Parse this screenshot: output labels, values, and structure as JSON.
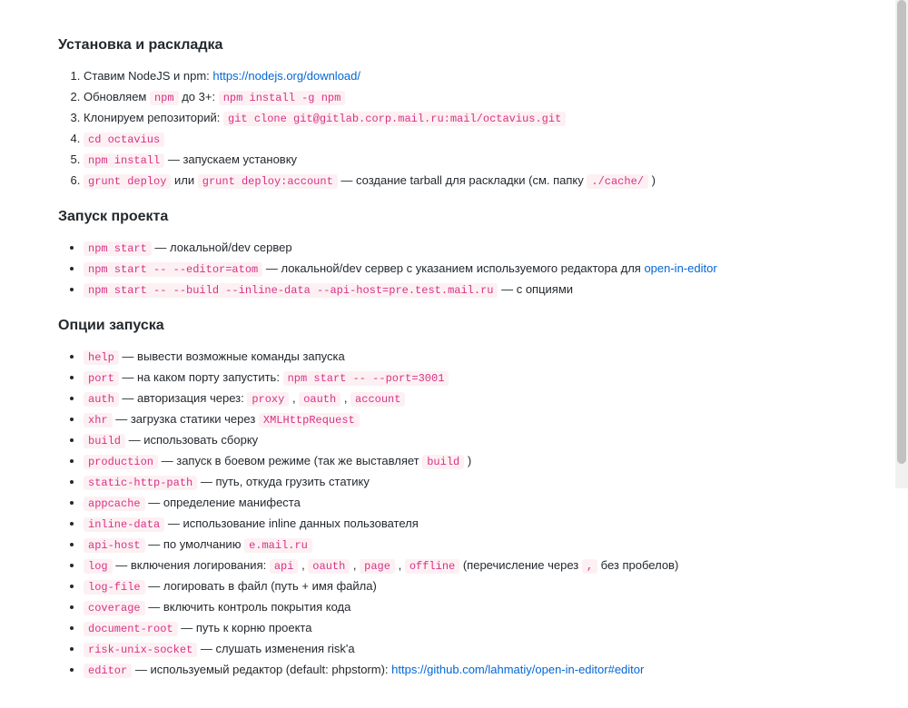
{
  "sections": {
    "install": {
      "heading": "Установка и раскладка",
      "items": [
        {
          "prefix": "Ставим NodeJS и npm: ",
          "link": "https://nodejs.org/download/"
        },
        {
          "prefix": "Обновляем ",
          "code1": "npm",
          "mid": " до 3+: ",
          "code2": "npm install -g npm"
        },
        {
          "prefix": "Клонируем репозиторий: ",
          "code1": "git clone git@gitlab.corp.mail.ru:mail/octavius.git"
        },
        {
          "code1": "cd octavius"
        },
        {
          "code1": "npm install",
          "suffix": " — запускаем установку"
        },
        {
          "code1": "grunt deploy",
          "mid": " или ",
          "code2": "grunt deploy:account",
          "suffix": " — создание tarball для раскладки (см. папку ",
          "code3": "./cache/",
          "suffix2": " )"
        }
      ]
    },
    "run": {
      "heading": "Запуск проекта",
      "items": [
        {
          "code1": "npm start",
          "suffix": " — локальной/dev сервер"
        },
        {
          "code1": "npm start -- --editor=atom",
          "suffix": " — локальной/dev сервер с указанием используемого редактора для ",
          "link": "open-in-editor"
        },
        {
          "code1": "npm start -- --build --inline-data --api-host=pre.test.mail.ru",
          "suffix": " — с опциями"
        }
      ]
    },
    "options": {
      "heading": "Опции запуска",
      "items": [
        {
          "code1": "help",
          "suffix": " — вывести возможные команды запуска"
        },
        {
          "code1": "port",
          "suffix": " — на каком порту запустить: ",
          "code2": "npm start -- --port=3001"
        },
        {
          "code1": "auth",
          "suffix": " — авторизация через: ",
          "code2": "proxy",
          "mid2": " , ",
          "code3": "oauth",
          "mid3": " , ",
          "code4": "account"
        },
        {
          "code1": "xhr",
          "suffix": " — загрузка статики через ",
          "code2": "XMLHttpRequest"
        },
        {
          "code1": "build",
          "suffix": " — использовать сборку"
        },
        {
          "code1": "production",
          "suffix": " — запуск в боевом режиме (так же выставляет ",
          "code2": "build",
          "suffix2": " )"
        },
        {
          "code1": "static-http-path",
          "suffix": " — путь, откуда грузить статику"
        },
        {
          "code1": "appcache",
          "suffix": " — определение манифеста"
        },
        {
          "code1": "inline-data",
          "suffix": " — использование inline данных пользователя"
        },
        {
          "code1": "api-host",
          "suffix": " — по умолчанию ",
          "code2": "e.mail.ru"
        },
        {
          "code1": "log",
          "suffix": " — включения логирования: ",
          "code2": "api",
          "mid2": " , ",
          "code3": "oauth",
          "mid3": " , ",
          "code4": "page",
          "mid4": " , ",
          "code5": "offline",
          "suffix2": " (перечисление через ",
          "code6": ",",
          "suffix3": " без пробелов)"
        },
        {
          "code1": "log-file",
          "suffix": " — логировать в файл (путь + имя файла)"
        },
        {
          "code1": "coverage",
          "suffix": " — включить контроль покрытия кода"
        },
        {
          "code1": "document-root",
          "suffix": " — путь к корню проекта"
        },
        {
          "code1": "risk-unix-socket",
          "suffix": " — слушать изменения risk'а"
        },
        {
          "code1": "editor",
          "suffix": " — используемый редактор (default: phpstorm): ",
          "link": "https://github.com/lahmatiy/open-in-editor#editor"
        }
      ]
    }
  }
}
